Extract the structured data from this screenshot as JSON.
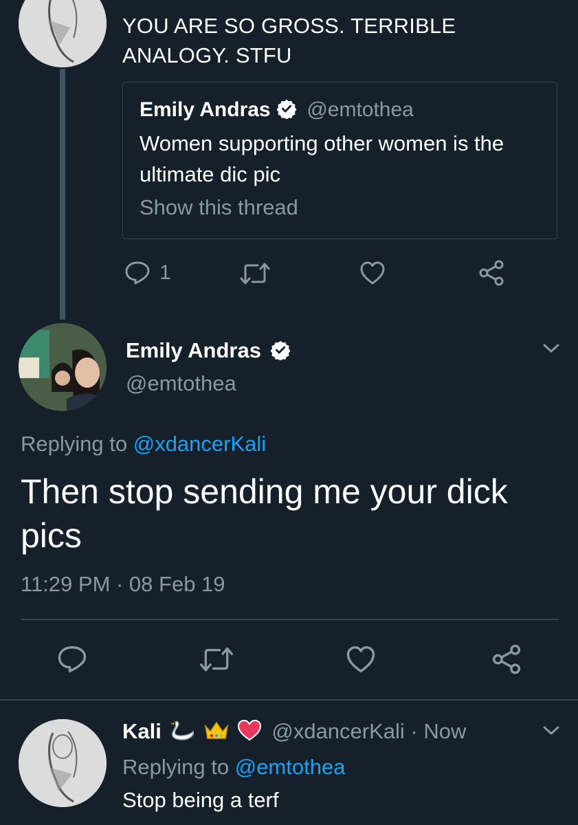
{
  "top_tweet": {
    "text": "YOU ARE SO GROSS. TERRIBLE ANALOGY. STFU",
    "quote": {
      "name": "Emily Andras",
      "handle": "@emtothea",
      "text": "Women supporting other women is the ultimate dic pic",
      "show_thread": "Show this thread"
    },
    "reply_count": "1"
  },
  "main_tweet": {
    "name": "Emily Andras",
    "handle": "@emtothea",
    "replying_prefix": "Replying to",
    "replying_handle": "@xdancerKali",
    "text": "Then stop sending me your dick pics",
    "timestamp": "11:29 PM · 08 Feb 19"
  },
  "bottom_tweet": {
    "name": "Kali",
    "handle_time": "@xdancerKali · Now",
    "replying_prefix": "Replying to",
    "replying_handle": "@emtothea",
    "text": "Stop being a terf"
  },
  "icons": [
    "reply-icon",
    "retweet-icon",
    "like-icon",
    "share-icon",
    "verified-icon",
    "chevron-down-icon",
    "swan-emoji",
    "crown-emoji",
    "heart-emoji"
  ],
  "colors": {
    "background": "#15202b",
    "muted": "#8899a6",
    "link": "#1da1f2",
    "border": "#38444d"
  }
}
